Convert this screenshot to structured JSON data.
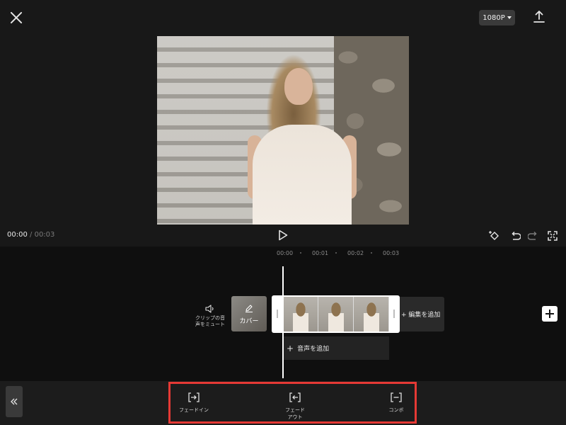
{
  "header": {
    "resolution_label": "1080P"
  },
  "playback": {
    "current_time": "00:00",
    "separator": "/",
    "total_time": "00:03"
  },
  "timeline": {
    "ruler": [
      "00:00",
      "00:01",
      "00:02",
      "00:03"
    ],
    "mute_label_line1": "クリップの音",
    "mute_label_line2": "声をミュート",
    "cover_label": "カバー",
    "add_edit_label": "+ 編集を追加",
    "add_audio_label": "音声を追加"
  },
  "toolbar": {
    "items": [
      {
        "label": "フェードイン",
        "icon": "fade-in-icon"
      },
      {
        "label": "フェード\nアウト",
        "label_line1": "フェード",
        "label_line2": "アウト",
        "icon": "fade-out-icon"
      },
      {
        "label": "コンボ",
        "icon": "combo-icon"
      }
    ],
    "highlight_color": "#e53935"
  }
}
